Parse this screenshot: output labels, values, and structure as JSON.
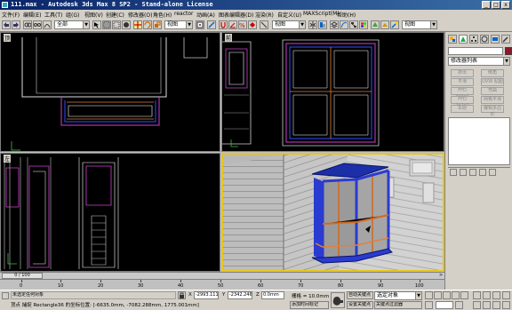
{
  "window": {
    "title": "111.max - Autodesk 3ds Max 8 SP2 - Stand-alone License"
  },
  "menu": [
    "文件(F)",
    "编辑(E)",
    "工具(T)",
    "组(G)",
    "视图(V)",
    "创建(C)",
    "修改器(O)",
    "角色(H)",
    "reactor",
    "动画(A)",
    "图表编辑器(D)",
    "渲染(R)",
    "自定义(U)",
    "MAXScript(M)",
    "帮助(H)"
  ],
  "toolbar": {
    "selection_filter": "全部",
    "ref_coord": "视图",
    "named_selection": "视图"
  },
  "viewports": {
    "top_left": "顶",
    "top_right": "前",
    "bottom_left": "左",
    "bottom_right": "透视"
  },
  "command_panel": {
    "object_name": "",
    "modifier_list": "修改器列表",
    "buttons": [
      "挤出",
      "倒角",
      "平滑",
      "FFD 4x4x4",
      "FFD 2x2x2",
      "编辑多边形",
      "车削",
      "UVW 贴图",
      "弯曲",
      "网格平滑"
    ]
  },
  "timeline": {
    "frame": "0 / 100",
    "ticks": [
      "0",
      "10",
      "20",
      "30",
      "40",
      "50",
      "60",
      "70",
      "80",
      "90",
      "100"
    ]
  },
  "status": {
    "selection": "未选定任何对象",
    "prompt": "顶点 捕捉 Rectangle36 的坐标位置: [-6635.0mm, -7082.288mm, 1775.001mm]",
    "x_label": "X",
    "x_value": "-2993.111",
    "y_label": "Y",
    "y_value": "-2342.246",
    "z_label": "Z",
    "z_value": "0.0mm",
    "grid": "栅格 = 10.0mm",
    "add_time_tag": "添加时间标记",
    "auto_key": "自动关键点",
    "set_key": "设置关键点",
    "selected_objects": "选定对象",
    "key_filters": "关键点过滤器"
  },
  "colors": {
    "title_blue": "#0a246a",
    "viewport_bg": "#000000",
    "active_border": "#e6c619",
    "window_frame": "#2a3bd0",
    "wall": "#c8c8c8"
  }
}
